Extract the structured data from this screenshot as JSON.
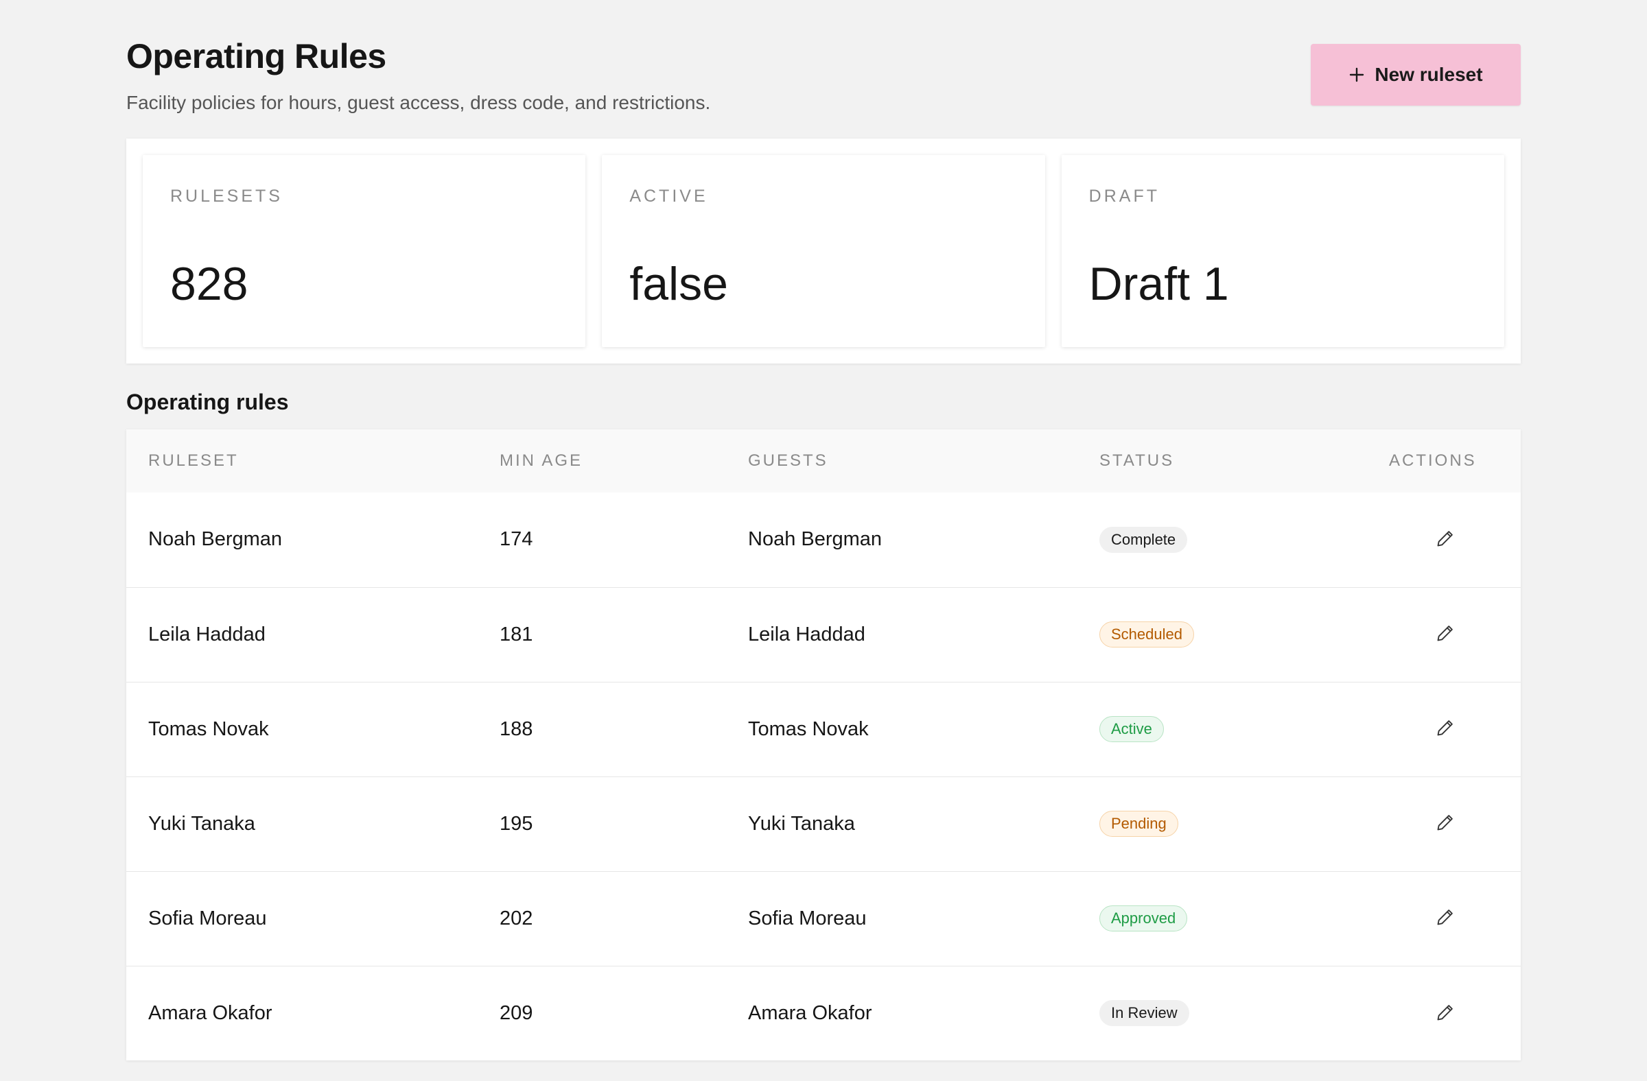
{
  "header": {
    "title": "Operating Rules",
    "subtitle": "Facility policies for hours, guest access, dress code, and restrictions.",
    "new_button_label": "New ruleset"
  },
  "stats": [
    {
      "label": "RULESETS",
      "value": "828"
    },
    {
      "label": "ACTIVE",
      "value": "false"
    },
    {
      "label": "DRAFT",
      "value": "Draft 1"
    }
  ],
  "section": {
    "title": "Operating rules"
  },
  "table": {
    "columns": [
      "RULESET",
      "MIN AGE",
      "GUESTS",
      "STATUS",
      "ACTIONS"
    ],
    "rows": [
      {
        "ruleset": "Noah Bergman",
        "min_age": "174",
        "guests": "Noah Bergman",
        "status": "Complete",
        "status_tone": "neutral"
      },
      {
        "ruleset": "Leila Haddad",
        "min_age": "181",
        "guests": "Leila Haddad",
        "status": "Scheduled",
        "status_tone": "amber"
      },
      {
        "ruleset": "Tomas Novak",
        "min_age": "188",
        "guests": "Tomas Novak",
        "status": "Active",
        "status_tone": "green"
      },
      {
        "ruleset": "Yuki Tanaka",
        "min_age": "195",
        "guests": "Yuki Tanaka",
        "status": "Pending",
        "status_tone": "amber"
      },
      {
        "ruleset": "Sofia Moreau",
        "min_age": "202",
        "guests": "Sofia Moreau",
        "status": "Approved",
        "status_tone": "green"
      },
      {
        "ruleset": "Amara Okafor",
        "min_age": "209",
        "guests": "Amara Okafor",
        "status": "In Review",
        "status_tone": "neutral"
      }
    ]
  },
  "icons": {
    "new_button": "plus-icon",
    "row_action": "pencil-icon"
  },
  "colors": {
    "background": "#f2f2f2",
    "primary_button": "#f6c0d6",
    "badge_amber_text": "#b35a00",
    "badge_green_text": "#1e9c45"
  }
}
